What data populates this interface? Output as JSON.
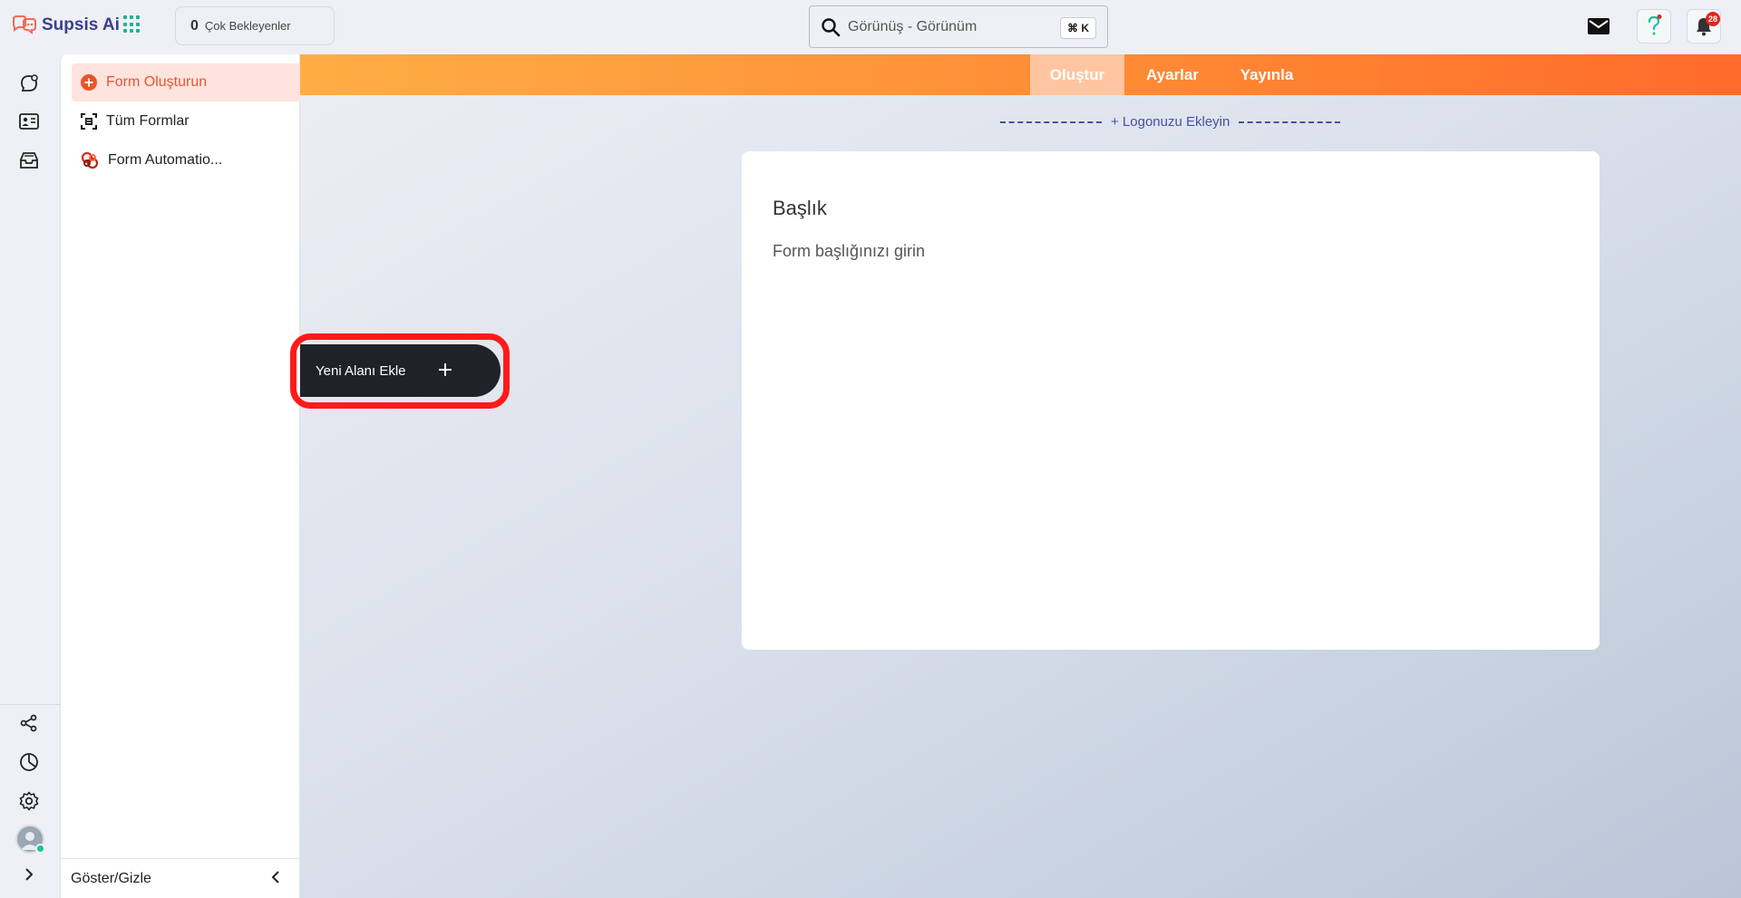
{
  "brand": {
    "name": "Supsis Ai",
    "accent": "#3b3f8f",
    "brand_orange": "#ff7a30"
  },
  "header": {
    "pending_count": "0",
    "pending_label": "Çok Bekleyenler",
    "search_value": "Görünüş - Görünüm",
    "search_shortcut": "⌘ K",
    "notification_count": "28"
  },
  "rail": {
    "icons": [
      "conversations-icon",
      "contacts-icon",
      "inbox-icon",
      "share-icon",
      "reports-icon",
      "settings-icon",
      "avatar"
    ]
  },
  "sidebar": {
    "items": [
      {
        "label": "Form Oluşturun",
        "icon": "plus-circle-icon",
        "active": true
      },
      {
        "label": "Tüm Formlar",
        "icon": "forms-icon",
        "active": false
      },
      {
        "label": "Form Automatio...",
        "icon": "automation-icon",
        "active": false
      }
    ],
    "footer_label": "Göster/Gizle"
  },
  "tabs": [
    {
      "label": "Oluştur",
      "active": true
    },
    {
      "label": "Ayarlar",
      "active": false
    },
    {
      "label": "Yayınla",
      "active": false
    }
  ],
  "canvas": {
    "add_logo_label": "+ Logonuzu Ekleyin",
    "title": "Başlık",
    "subtitle": "Form başlığınızı girin",
    "add_field_label": "Yeni Alanı Ekle"
  }
}
